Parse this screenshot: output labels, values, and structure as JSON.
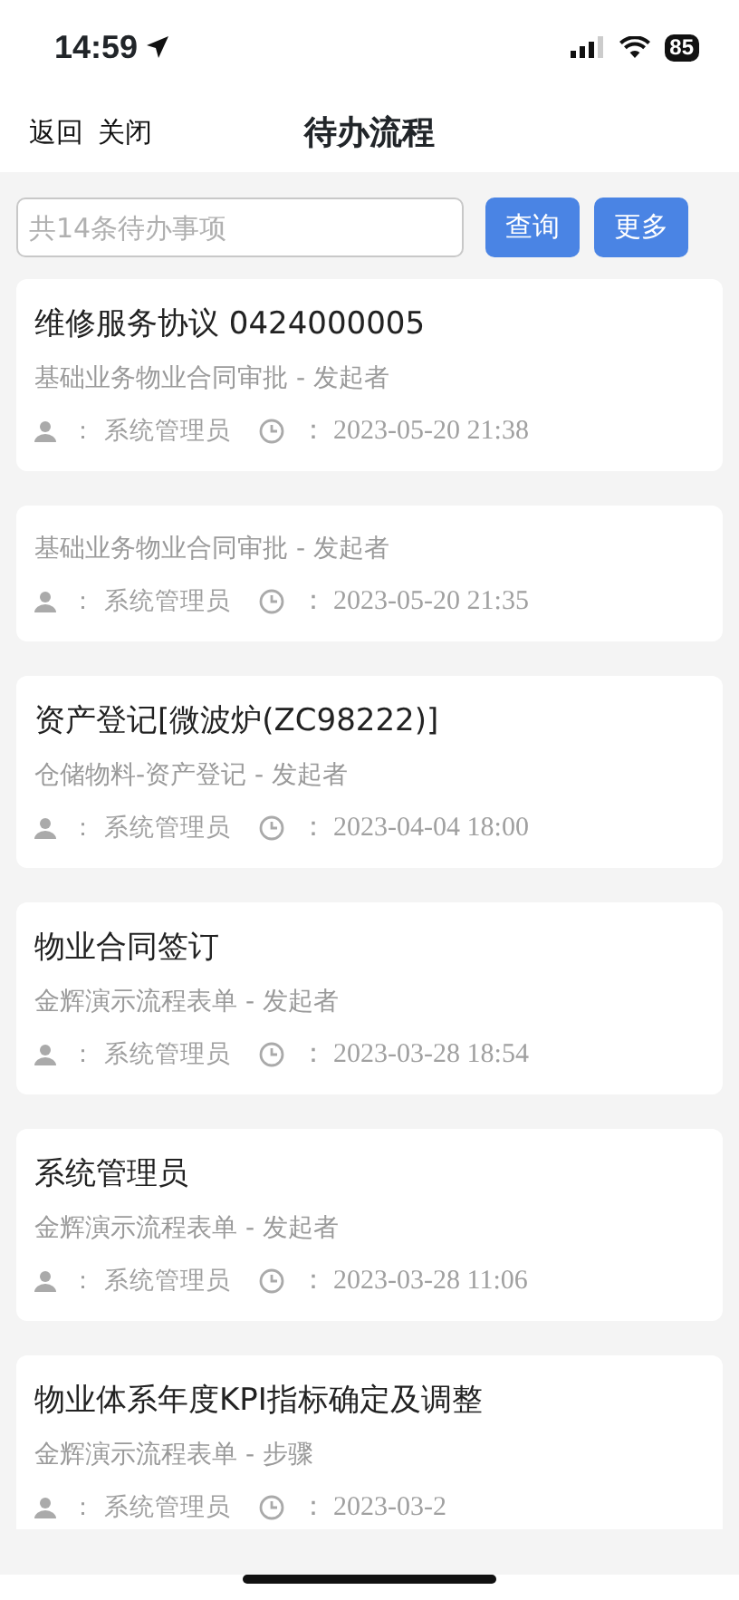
{
  "status_bar": {
    "time": "14:59",
    "battery": "85"
  },
  "nav": {
    "back": "返回",
    "close": "关闭",
    "title": "待办流程"
  },
  "search": {
    "placeholder": "共14条待办事项",
    "buttons": [
      "查询",
      "更多"
    ]
  },
  "items": [
    {
      "title": "维修服务协议 0424000005",
      "subtitle": "基础业务物业合同审批 - 发起者",
      "user": "： 系统管理员",
      "time": "： 2023-05-20 21:38"
    },
    {
      "subtitle": "基础业务物业合同审批 - 发起者",
      "user": "： 系统管理员",
      "time": "： 2023-05-20 21:35"
    },
    {
      "title": "资产登记[微波炉(ZC98222)]",
      "subtitle": "仓储物料-资产登记 - 发起者",
      "user": "： 系统管理员",
      "time": "： 2023-04-04 18:00"
    },
    {
      "title": "物业合同签订",
      "subtitle": "金辉演示流程表单 - 发起者",
      "user": "： 系统管理员",
      "time": "： 2023-03-28 18:54"
    },
    {
      "title": "系统管理员",
      "subtitle": "金辉演示流程表单 - 发起者",
      "user": "： 系统管理员",
      "time": "： 2023-03-28 11:06"
    },
    {
      "title": "物业体系年度KPI指标确定及调整",
      "subtitle": "金辉演示流程表单 - 步骤",
      "user": "： 系统管理员",
      "time": "： 2023-03-2"
    }
  ]
}
